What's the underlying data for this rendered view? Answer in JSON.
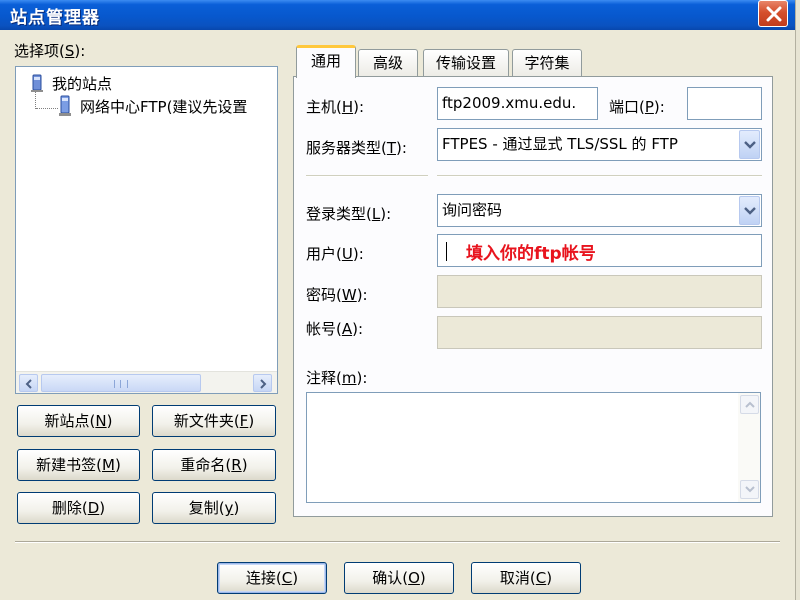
{
  "window": {
    "title": "站点管理器"
  },
  "left": {
    "select_label": "选择项(S):",
    "tree": [
      {
        "label": "我的站点"
      },
      {
        "label": "网络中心FTP(建议先设置"
      }
    ],
    "buttons": {
      "new_site": "新站点(N)",
      "new_folder": "新文件夹(F)",
      "new_bookmark": "新建书签(M)",
      "rename": "重命名(R)",
      "delete": "删除(D)",
      "copy": "复制(y)"
    }
  },
  "tabs": [
    {
      "label": "通用",
      "active": true
    },
    {
      "label": "高级",
      "active": false
    },
    {
      "label": "传输设置",
      "active": false
    },
    {
      "label": "字符集",
      "active": false
    }
  ],
  "general": {
    "host_label": "主机(H):",
    "host_value": "ftp2009.xmu.edu.",
    "port_label": "端口(P):",
    "port_value": "",
    "server_type_label": "服务器类型(T):",
    "server_type_value": "FTPES - 通过显式 TLS/SSL 的 FTP",
    "logon_type_label": "登录类型(L):",
    "logon_type_value": "询问密码",
    "user_label": "用户(U):",
    "user_value": "",
    "user_hint": "填入你的ftp帐号",
    "password_label": "密码(W):",
    "account_label": "帐号(A):",
    "comments_label": "注释(m):",
    "comments_value": ""
  },
  "footer": {
    "connect": "连接(C)",
    "ok": "确认(O)",
    "cancel": "取消(C)"
  },
  "colors": {
    "title_bar": "#0758cd",
    "hint_text": "#e8141e",
    "active_tab_accent": "#ffc83c",
    "dialog_bg": "#ece9d8"
  }
}
